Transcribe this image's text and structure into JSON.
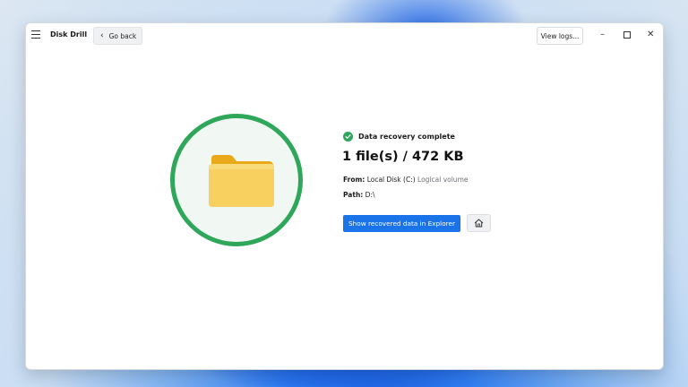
{
  "app": {
    "title": "Disk Drill"
  },
  "toolbar": {
    "back_label": "Go back",
    "logs_label": "View logs...",
    "minimize": "–",
    "close": "✕"
  },
  "result": {
    "status": "Data recovery complete",
    "summary": "1 file(s) / 472 KB",
    "from_label": "From:",
    "from_value": "Local Disk (C:)",
    "from_type": "Logical volume",
    "path_label": "Path:",
    "path_value": "D:\\"
  },
  "actions": {
    "explorer_label": "Show recovered data in Explorer"
  },
  "colors": {
    "accent": "#1a73e8",
    "success": "#2fa75a",
    "folder": "#f6c63d"
  }
}
